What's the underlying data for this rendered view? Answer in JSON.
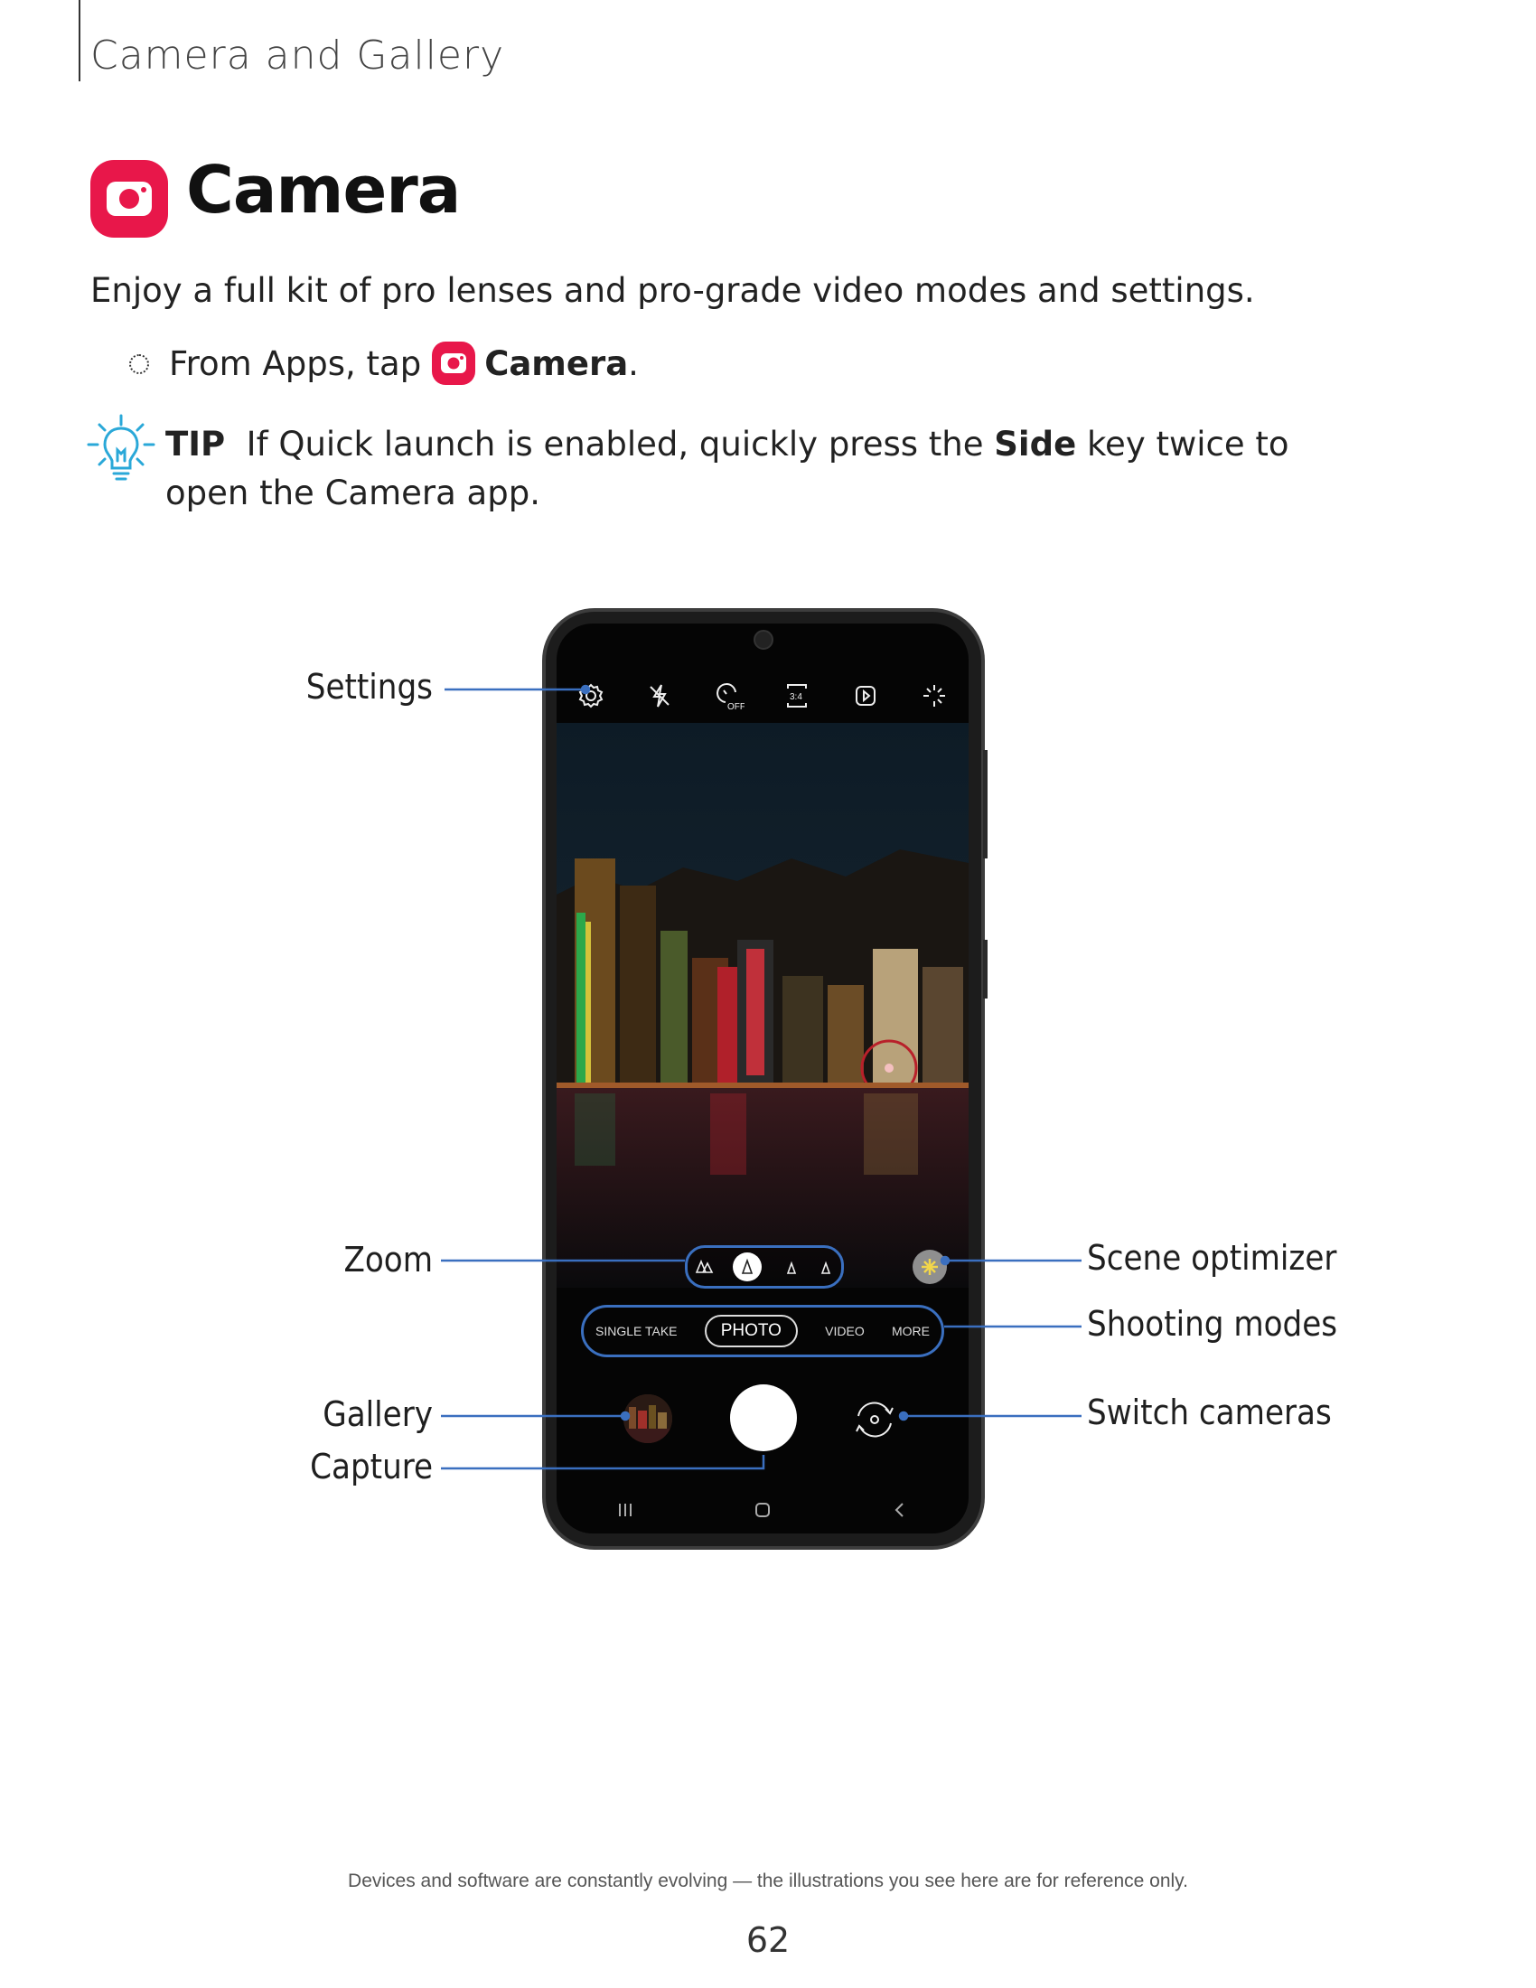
{
  "header": {
    "section_title": "Camera and Gallery"
  },
  "title": {
    "text": "Camera",
    "icon": "camera-app-icon"
  },
  "intro": "Enjoy a full kit of pro lenses and pro-grade video modes and settings.",
  "step": {
    "prefix": "From Apps, tap",
    "app_name": "Camera",
    "suffix": "."
  },
  "tip": {
    "label": "TIP",
    "text_1": "If Quick launch is enabled, quickly press the",
    "key": "Side",
    "text_2": "key twice to open the Camera app."
  },
  "phone": {
    "top_icons": [
      "settings-icon",
      "flash-off-icon",
      "timer-off-icon",
      "ratio-icon",
      "motion-photo-icon",
      "filter-icon"
    ],
    "ratio_label": "3:4",
    "timer_label": "OFF",
    "shooting_modes": [
      {
        "label": "SINGLE TAKE",
        "active": false
      },
      {
        "label": "PHOTO",
        "active": true
      },
      {
        "label": "VIDEO",
        "active": false
      },
      {
        "label": "MORE",
        "active": false
      }
    ]
  },
  "callouts": {
    "settings": "Settings",
    "zoom": "Zoom",
    "gallery": "Gallery",
    "capture": "Capture",
    "scene_optimizer": "Scene optimizer",
    "shooting_modes": "Shooting modes",
    "switch_cameras": "Switch cameras"
  },
  "colors": {
    "brand_red": "#e8174a",
    "callout_line": "#3a6fbf",
    "tip_icon": "#2aa8d8"
  },
  "footer": {
    "note": "Devices and software are constantly evolving — the illustrations you see here are for reference only.",
    "page_number": "62"
  }
}
